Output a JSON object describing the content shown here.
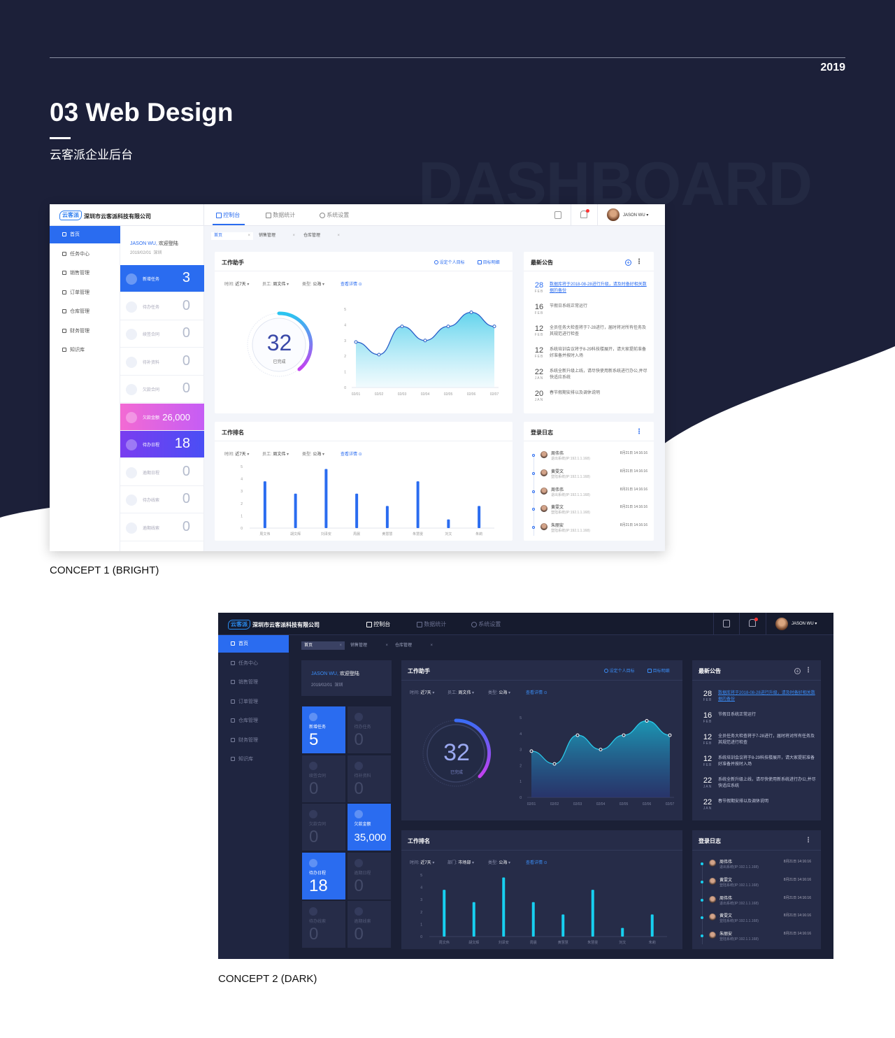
{
  "header": {
    "year": "2019",
    "title": "03 Web Design",
    "subtitle": "云客派企业后台",
    "watermark": "DASHBOARD"
  },
  "captions": {
    "concept1": "CONCEPT 1 (BRIGHT)",
    "concept2": "CONCEPT 2 (DARK)"
  },
  "colors": {
    "navy": "#1c2039",
    "primary": "#2a6cf0",
    "cyan": "#17d0f0",
    "pink": "#f36ad3",
    "purple": "#7a3df0",
    "dark_bg": "#1b2036",
    "dark_panel": "#262c48"
  },
  "app": {
    "logo": "云客派",
    "company": "深圳市云客派科技有限公司",
    "nav": [
      "控制台",
      "数据统计",
      "系统设置"
    ],
    "user": "JASON WU",
    "sidebar": [
      "首页",
      "任务中心",
      "销售管理",
      "订单管理",
      "仓库管理",
      "财务管理",
      "知识库"
    ],
    "tabs": [
      "首页",
      "销售管理",
      "仓库管理"
    ],
    "tab_close": "×",
    "welcome_name": "JASON WU,",
    "welcome_text": "欢迎登陆",
    "welcome_date": "2019/02/01",
    "welcome_city": "深圳",
    "assistant": {
      "title": "工作助手",
      "set_goal": "设定个人目标",
      "goal_detail": "目标明细",
      "filters": [
        {
          "label": "时间:",
          "value": "近7天"
        },
        {
          "label": "员工:",
          "value": "周文伟"
        },
        {
          "label": "类型:",
          "value": "公海"
        }
      ],
      "details_link": "查看详情",
      "donut_value": "32",
      "donut_label": "已完成"
    },
    "ranking": {
      "title": "工作排名",
      "filters1": [
        {
          "label": "时间:",
          "value": "近7天"
        },
        {
          "label": "员工:",
          "value": "周文伟"
        },
        {
          "label": "类型:",
          "value": "公海"
        }
      ],
      "filters2": [
        {
          "label": "时间:",
          "value": "近7天"
        },
        {
          "label": "部门:",
          "value": "市场部"
        },
        {
          "label": "类型:",
          "value": "公海"
        }
      ],
      "details_link": "查看详情"
    },
    "notices_title": "最新公告",
    "notices": [
      {
        "day": "28",
        "month": "FEB",
        "text": "数据库将于2018-08-28进行升级，请及时备好相关数据的备份"
      },
      {
        "day": "16",
        "month": "FEB",
        "text": "节假日系统正常运行"
      },
      {
        "day": "12",
        "month": "FEB",
        "text": "全员任务大检查将于7-28进行，届时将对所有任务及其规范进行检查"
      },
      {
        "day": "12",
        "month": "FEB",
        "text": "系统培训会议将于8-29科技楼展开，请大家提前准备好准备并按时入场"
      },
      {
        "day": "22",
        "month": "JAN",
        "text": "系统全新升级上线，请尽快使用新系统进行办公,并尽快适应系统"
      },
      {
        "day": "20",
        "month": "JAN",
        "text": "春节假期安排以及调休说明"
      }
    ],
    "notices_dark_last_day": "22",
    "log_title": "登录日志",
    "logs": [
      {
        "name": "周伟伟",
        "sub": "退出系统(IP:192.1.1.168)",
        "time": "8月21日 14:16:16"
      },
      {
        "name": "黄雯文",
        "sub": "登陆系统(IP:192.1.1.168)",
        "time": "8月21日 14:16:16"
      },
      {
        "name": "周伟伟",
        "sub": "退出系统(IP:192.1.1.168)",
        "time": "8月21日 14:16:16"
      },
      {
        "name": "黄雯文",
        "sub": "登陆系统(IP:192.1.1.168)",
        "time": "8月21日 14:16:16"
      },
      {
        "name": "朱丽安",
        "sub": "登陆系统(IP:192.1.1.168)",
        "time": "8月21日 14:16:16"
      }
    ]
  },
  "stats_bright": [
    {
      "label": "新增任务",
      "value": "3",
      "style": "blue"
    },
    {
      "label": "待办任务",
      "value": "0",
      "style": "plain"
    },
    {
      "label": "续签合同",
      "value": "0",
      "style": "plain"
    },
    {
      "label": "待补资料",
      "value": "0",
      "style": "plain"
    },
    {
      "label": "欠款合同",
      "value": "0",
      "style": "plain"
    },
    {
      "label": "欠款金额",
      "value": "26,000",
      "style": "pink"
    },
    {
      "label": "待办日程",
      "value": "18",
      "style": "purple"
    },
    {
      "label": "逾期日程",
      "value": "0",
      "style": "plain"
    },
    {
      "label": "待办线索",
      "value": "0",
      "style": "plain"
    },
    {
      "label": "逾期线索",
      "value": "0",
      "style": "plain"
    }
  ],
  "stats_dark": [
    {
      "label": "新增任务",
      "value": "5",
      "style": "blue"
    },
    {
      "label": "待办任务",
      "value": "0",
      "style": "plain"
    },
    {
      "label": "续签合同",
      "value": "0",
      "style": "plain"
    },
    {
      "label": "待补资料",
      "value": "0",
      "style": "plain"
    },
    {
      "label": "欠款合同",
      "value": "0",
      "style": "plain"
    },
    {
      "label": "欠款金额",
      "value": "35,000",
      "style": "blue"
    },
    {
      "label": "待办日程",
      "value": "18",
      "style": "blue"
    },
    {
      "label": "逾期日程",
      "value": "0",
      "style": "plain"
    },
    {
      "label": "待办线索",
      "value": "0",
      "style": "plain"
    },
    {
      "label": "逾期线索",
      "value": "0",
      "style": "plain"
    }
  ],
  "chart_data": [
    {
      "type": "area",
      "x": [
        "02/01",
        "02/02",
        "02/03",
        "02/04",
        "02/05",
        "02/06",
        "02/07"
      ],
      "values": [
        2.9,
        2.1,
        3.9,
        3.0,
        3.9,
        4.8,
        3.9
      ],
      "ylim": [
        0,
        5
      ],
      "yticks": [
        0,
        1,
        2,
        3,
        4,
        5
      ]
    },
    {
      "type": "bar",
      "categories": [
        "周文伟",
        "胡文辉",
        "刘泽安",
        "周晨",
        "黄慧慧",
        "朱慧雯",
        "刘文",
        "朱莉"
      ],
      "values": [
        3.8,
        2.8,
        4.8,
        2.8,
        1.8,
        3.8,
        0.7,
        1.8
      ],
      "ylim": [
        0,
        5
      ],
      "yticks": [
        0,
        1,
        2,
        3,
        4,
        5
      ]
    }
  ]
}
